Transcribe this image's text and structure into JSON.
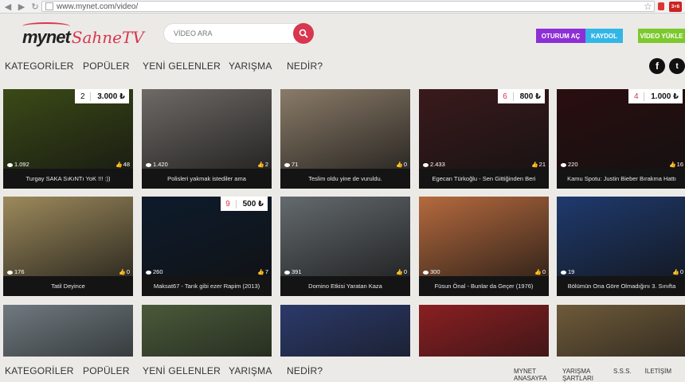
{
  "browser": {
    "url": "www.mynet.com/video/",
    "ext_badge": "3+6"
  },
  "header": {
    "logo_mynet": "mynet",
    "logo_sahne": "SahneTV",
    "search_placeholder": "VİDEO ARA",
    "login_label": "OTURUM AÇ",
    "register_label": "KAYDOL",
    "upload_label": "VİDEO YÜKLE"
  },
  "nav": [
    "KATEGORİLER",
    "POPÜLER",
    "YENİ GELENLER",
    "YARIŞMA",
    "NEDİR?"
  ],
  "social": {
    "facebook": "f",
    "twitter": "t"
  },
  "footer": [
    "MYNET ANASAYFA",
    "YARIŞMA ŞARTLARI",
    "S.S.S.",
    "İLETİŞİM"
  ],
  "videos": [
    {
      "title": "Turgay SAKA SıKıNTı YoK !!! :))",
      "views": "1.092",
      "likes": "48",
      "rank": "2",
      "votes": "3.000 ₺",
      "bg": "#3b4a17"
    },
    {
      "title": "Polisleri yakmak istediler ama",
      "views": "1.420",
      "likes": "2",
      "bg": "#6e6a66"
    },
    {
      "title": "Teslim oldu yine de vuruldu.",
      "views": "71",
      "likes": "0",
      "bg": "#8a7b68"
    },
    {
      "title": "Egecan Türkoğlu - Sen Gittiğinden Beri",
      "views": "2.433",
      "likes": "21",
      "rank": "6",
      "votes": "800 ₺",
      "bg": "#3a1a1c"
    },
    {
      "title": "Kamu Spotu: Justin Bieber Bırakma Hattı",
      "views": "220",
      "likes": "16",
      "rank": "4",
      "votes": "1.000 ₺",
      "bg": "#2a0e10"
    },
    {
      "title": "Tatil Deyince",
      "views": "176",
      "likes": "0",
      "bg": "#9d8a5c"
    },
    {
      "title": "Maksat67 - Tarık gibi ezer Rapim (2013)",
      "views": "260",
      "likes": "7",
      "rank": "9",
      "votes": "500 ₺",
      "bg": "#0e1b2c"
    },
    {
      "title": "Domino Etkisi Yaratan Kaza",
      "views": "391",
      "likes": "0",
      "bg": "#646a6e"
    },
    {
      "title": "Füsun Önal - Bunlar da Geçer (1976)",
      "views": "300",
      "likes": "0",
      "bg": "#b56a3e"
    },
    {
      "title": "Bölümün Ona Göre Olmadığını 3. Sınıfta",
      "views": "19",
      "likes": "0",
      "bg": "#1f3a6e"
    },
    {
      "title": "",
      "views": "",
      "likes": "",
      "bg": "#6f7a80"
    },
    {
      "title": "",
      "views": "",
      "likes": "",
      "bg": "#4a5a3a"
    },
    {
      "title": "",
      "views": "",
      "likes": "",
      "bg": "#2c3a6a"
    },
    {
      "title": "",
      "views": "",
      "likes": "",
      "bg": "#8a1f22"
    },
    {
      "title": "",
      "views": "",
      "likes": "",
      "bg": "#6e5a3a"
    }
  ]
}
